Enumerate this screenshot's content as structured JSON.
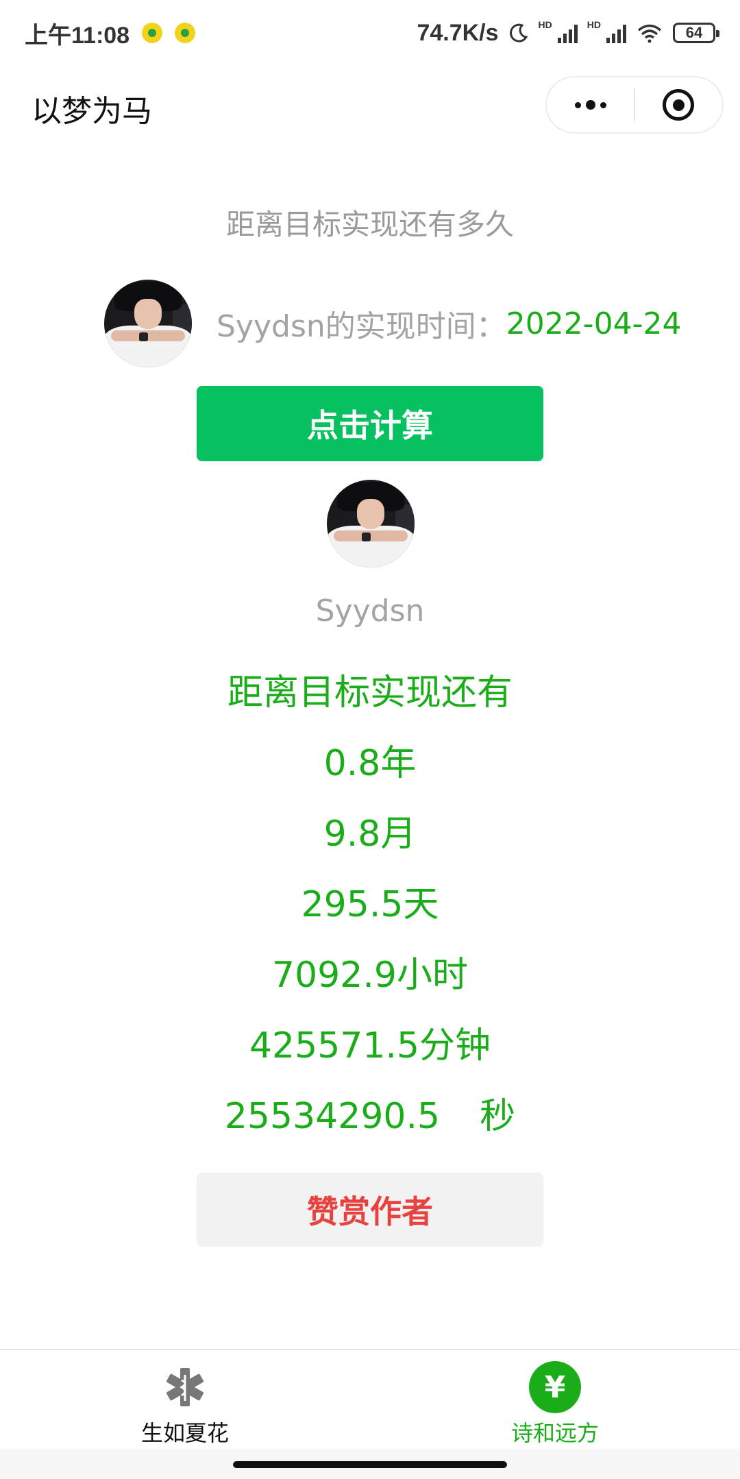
{
  "status_bar": {
    "time": "上午11:08",
    "net_speed": "74.7K/s",
    "hd1": "HD",
    "hd2": "HD",
    "battery": "64"
  },
  "nav": {
    "title": "以梦为马",
    "menu_icon": "more-dots-icon",
    "close_icon": "target-circle-icon"
  },
  "main": {
    "subtitle": "距离目标实现还有多久",
    "deadline_label": "Syydsn的实现时间：",
    "deadline_date": "2022-04-24",
    "calc_button": "点击计算",
    "username": "Syydsn",
    "results": {
      "heading": "距离目标实现还有",
      "years": "0.8年",
      "months": "9.8月",
      "days": "295.5天",
      "hours": "7092.9小时",
      "minutes": "425571.5分钟",
      "seconds_value": "25534290.5",
      "seconds_unit": "秒"
    },
    "reward_button": "赞赏作者"
  },
  "tabbar": {
    "tabs": [
      {
        "label": "生如夏花",
        "icon": "medical-star-icon",
        "active": false
      },
      {
        "label": "诗和远方",
        "icon": "yen-icon",
        "active": true
      }
    ],
    "yen_glyph": "¥"
  },
  "colors": {
    "accent_green": "#1aad19",
    "button_green": "#07c160",
    "reward_red": "#e64340",
    "muted_text": "#a3a3a3"
  }
}
